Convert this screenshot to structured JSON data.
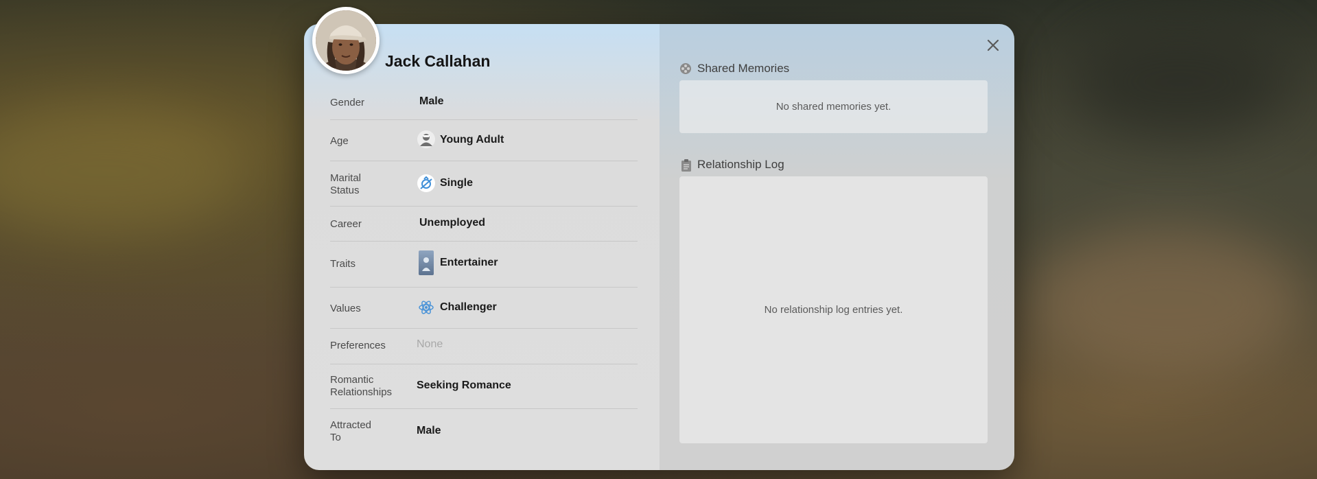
{
  "profile": {
    "name": "Jack Callahan",
    "fields": [
      {
        "label": "Gender",
        "value": "Male",
        "icon": null
      },
      {
        "label": "Age",
        "value": "Young Adult",
        "icon": "young-adult-age-icon"
      },
      {
        "label": "Marital\nStatus",
        "value": "Single",
        "icon": "single-status-icon"
      },
      {
        "label": "Career",
        "value": "Unemployed",
        "icon": null
      },
      {
        "label": "Traits",
        "value": "Entertainer",
        "icon": "entertainer-trait-icon"
      },
      {
        "label": "Values",
        "value": "Challenger",
        "icon": "challenger-value-icon"
      },
      {
        "label": "Preferences",
        "value": "None",
        "icon": null,
        "muted": true
      },
      {
        "label": "Romantic\nRelationships",
        "value": "Seeking Romance",
        "icon": null
      },
      {
        "label": "Attracted\nTo",
        "value": "Male",
        "icon": null
      }
    ]
  },
  "shared_memories": {
    "title": "Shared Memories",
    "empty_text": "No shared memories yet.",
    "icon": "film-reel-icon"
  },
  "relationship_log": {
    "title": "Relationship Log",
    "empty_text": "No relationship log entries yet.",
    "icon": "clipboard-icon"
  },
  "controls": {
    "close_icon": "close-icon"
  },
  "colors": {
    "accent_blue": "#3f8fd8",
    "header_tint": "#c6dff3",
    "muted_text": "#a8a8a8"
  }
}
